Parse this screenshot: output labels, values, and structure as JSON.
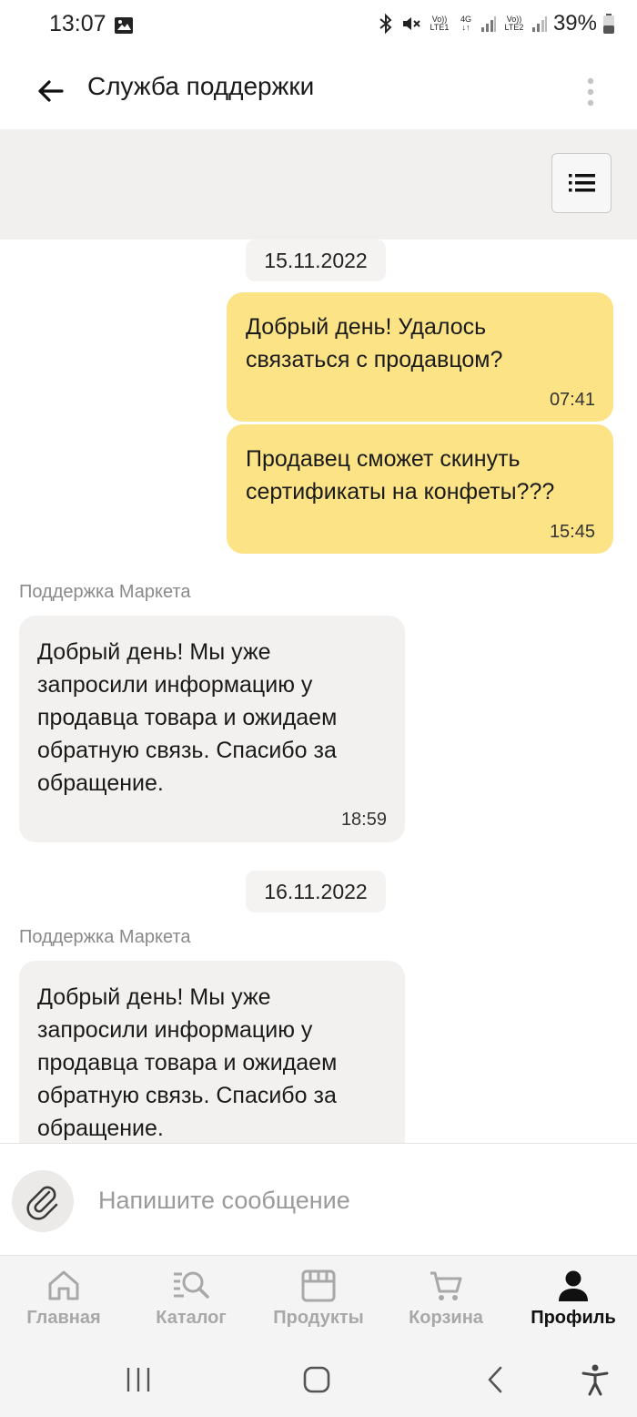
{
  "status_bar": {
    "time": "13:07",
    "battery": "39%",
    "net1": "Vo))",
    "net1b": "LTE1",
    "net2": "4G",
    "net3": "Vo))",
    "net3b": "LTE2",
    "icons": [
      "image-icon",
      "bluetooth-icon",
      "mute-icon",
      "signal-icon",
      "battery-icon"
    ]
  },
  "header": {
    "title": "Служба поддержки"
  },
  "chat": {
    "dates": [
      "15.11.2022",
      "16.11.2022"
    ],
    "messages": [
      {
        "from": "user",
        "text": "Добрый день! Удалось\nсвязаться с продавцом?",
        "time": "07:41"
      },
      {
        "from": "user",
        "text": "Продавец сможет скинуть\nсертификаты на конфеты???",
        "time": "15:45"
      },
      {
        "from": "support",
        "sender": "Поддержка Маркета",
        "text": "Добрый день! Мы уже\nзапросили информацию у\nпродавца товара и ожидаем\nобратную связь. Спасибо за\nобращение.",
        "time": "18:59"
      },
      {
        "from": "support",
        "sender": "Поддержка Маркета",
        "text": "Добрый день! Мы уже\nзапросили информацию у\nпродавца товара и ожидаем\nобратную связь. Спасибо за\nобращение."
      }
    ]
  },
  "input": {
    "placeholder": "Напишите сообщение",
    "value": ""
  },
  "bottom_nav": {
    "items": [
      {
        "label": "Главная",
        "icon": "home-icon"
      },
      {
        "label": "Каталог",
        "icon": "catalog-search-icon"
      },
      {
        "label": "Продукты",
        "icon": "store-icon"
      },
      {
        "label": "Корзина",
        "icon": "cart-icon"
      },
      {
        "label": "Профиль",
        "icon": "profile-icon"
      }
    ],
    "active": "Профиль"
  },
  "colors": {
    "outgoing_bubble": "#fbe386",
    "incoming_bubble": "#f2f1ef",
    "band": "#f1f0ee"
  }
}
